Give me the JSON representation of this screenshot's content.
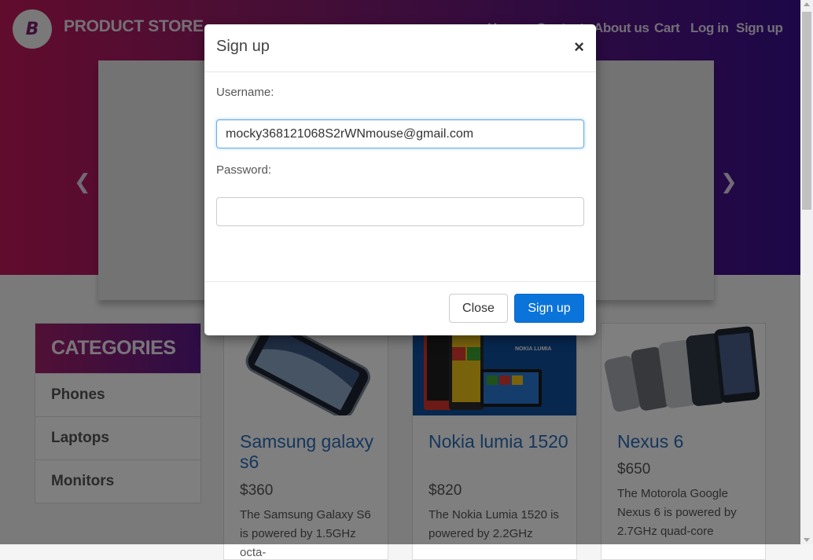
{
  "brand": {
    "logo_letter": "B",
    "name": "PRODUCT STORE"
  },
  "nav": [
    {
      "label": "Home"
    },
    {
      "label": "Contact"
    },
    {
      "label": "About us"
    },
    {
      "label": "Cart"
    },
    {
      "label": "Log in"
    },
    {
      "label": "Sign up"
    }
  ],
  "carousel": {
    "prev_icon": "chevron-left-icon",
    "next_icon": "chevron-right-icon",
    "prev_glyph": "❮",
    "next_glyph": "❯"
  },
  "categories": {
    "header": "CATEGORIES",
    "items": [
      {
        "label": "Phones"
      },
      {
        "label": "Laptops"
      },
      {
        "label": "Monitors"
      }
    ]
  },
  "products": [
    {
      "title": "Samsung galaxy s6",
      "price": "$360",
      "desc": "The Samsung Galaxy S6 is powered by 1.5GHz octa-"
    },
    {
      "title": "Nokia lumia 1520",
      "price": "$820",
      "desc": "The Nokia Lumia 1520 is powered by 2.2GHz",
      "image_text": "NOKIA LUMIA"
    },
    {
      "title": "Nexus 6",
      "price": "$650",
      "desc": "The Motorola Google Nexus 6 is powered by 2.7GHz quad-core"
    }
  ],
  "modal": {
    "title": "Sign up",
    "close_glyph": "×",
    "username_label": "Username:",
    "username_value": "mocky368121068S2rWNmouse@gmail.com",
    "password_label": "Password:",
    "password_value": "",
    "close_button": "Close",
    "signup_button": "Sign up"
  },
  "colors": {
    "accent": "#0a74da",
    "link": "#2a6cb8",
    "hero_start": "#c2185b",
    "hero_end": "#3a0f8f"
  }
}
